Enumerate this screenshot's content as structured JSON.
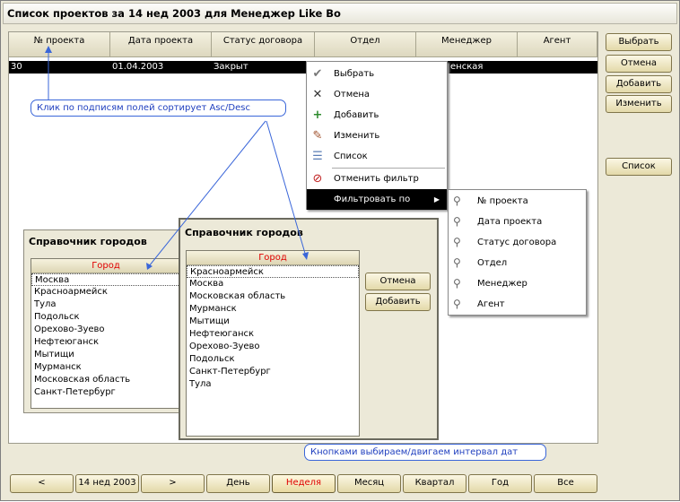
{
  "window": {
    "title": "Список проектов за 14 нед 2003  для Менеджер Like Bo"
  },
  "grid": {
    "columns": [
      "№ проекта",
      "Дата проекта",
      "Статус договора",
      "Отдел",
      "Менеджер",
      "Агент"
    ],
    "row": [
      "30",
      "01.04.2003",
      "Закрыт",
      "енская"
    ]
  },
  "side_buttons": {
    "select": "Выбрать",
    "cancel": "Отмена",
    "add": "Добавить",
    "edit": "Изменить",
    "list": "Список"
  },
  "context_menu": {
    "items": [
      {
        "label": "Выбрать",
        "icon": "checkmark-icon"
      },
      {
        "label": "Отмена",
        "icon": "cross-icon"
      },
      {
        "label": "Добавить",
        "icon": "add-icon"
      },
      {
        "label": "Изменить",
        "icon": "edit-icon"
      },
      {
        "label": "Список",
        "icon": "list-icon"
      },
      {
        "label": "Отменить фильтр",
        "icon": "filter-off-icon"
      }
    ],
    "filter_by": "Фильтровать по",
    "submenu": [
      "№ проекта",
      "Дата проекта",
      "Статус договора",
      "Отдел",
      "Менеджер",
      "Агент"
    ]
  },
  "city_dialog_back": {
    "title": "Справочник городов",
    "column": "Город",
    "items": [
      "Москва",
      "Красноармейск",
      "Тула",
      "Подольск",
      "Орехово-Зуево",
      "Нефтеюганск",
      "Мытищи",
      "Мурманск",
      "Московская область",
      "Санкт-Петербург"
    ]
  },
  "city_dialog_front": {
    "title": "Справочник городов",
    "column": "Город",
    "items": [
      "Красноармейск",
      "Москва",
      "Московская область",
      "Мурманск",
      "Мытищи",
      "Нефтеюганск",
      "Орехово-Зуево",
      "Подольск",
      "Санкт-Петербург",
      "Тула"
    ],
    "cancel": "Отмена",
    "add": "Добавить"
  },
  "callouts": {
    "sort": "Клик по подписям полей сортирует Asc/Desc",
    "dates": "Кнопками выбираем/двигаем интервал дат"
  },
  "bottom_bar": {
    "prev": "<",
    "period": "14 нед 2003",
    "next": ">",
    "day": "День",
    "week": "Неделя",
    "month": "Месяц",
    "quarter": "Квартал",
    "year": "Год",
    "all": "Все"
  },
  "colors": {
    "accent_red": "#e00000",
    "callout_blue": "#1f3fbf",
    "button_face": "#ece2b8"
  }
}
